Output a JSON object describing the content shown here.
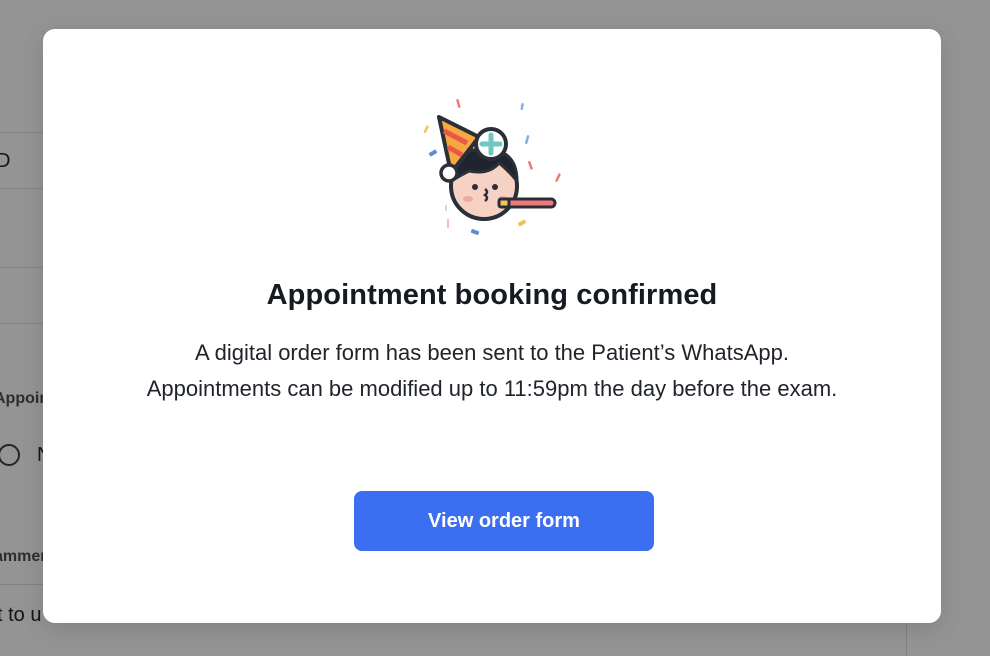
{
  "background": {
    "row1_text": "D",
    "section_label": "Appointr",
    "radio_label": "N",
    "comments_label": "ammen",
    "comments_text": "t to u"
  },
  "modal": {
    "title": "Appointment booking confirmed",
    "description": "A digital order form has been sent to the Patient’s WhatsApp. Appointments can be modified up to 11:59pm the day before the exam.",
    "primary_button_label": "View order form",
    "illustration_icon": "party-doctor-icon"
  },
  "colors": {
    "overlay": "#000000",
    "primary": "#3b6ef0",
    "title": "#161a21"
  }
}
